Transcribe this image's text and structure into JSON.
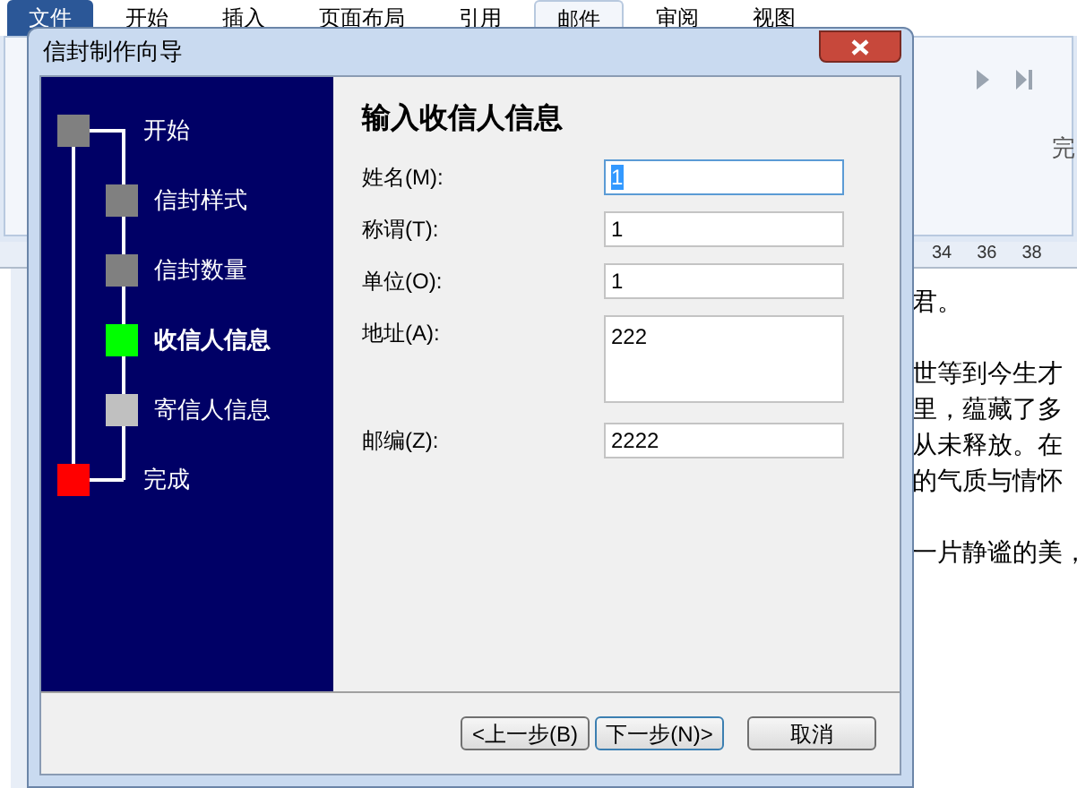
{
  "ribbon": {
    "file_button": "文件",
    "tabs": [
      {
        "label": "开始",
        "selected": false
      },
      {
        "label": "插入",
        "selected": false
      },
      {
        "label": "页面布局",
        "selected": false
      },
      {
        "label": "引用",
        "selected": false
      },
      {
        "label": "邮件",
        "selected": true
      },
      {
        "label": "审阅",
        "selected": false
      },
      {
        "label": "视图",
        "selected": false
      }
    ],
    "group_label": "完"
  },
  "ruler": {
    "ticks": [
      "34",
      "36",
      "38"
    ]
  },
  "document": {
    "paragraphs": [
      [
        "君。"
      ],
      [
        "世等到今生才",
        "里，蕴藏了多",
        "从未释放。在",
        "的气质与情怀"
      ],
      [
        "一片静谧的美，"
      ]
    ]
  },
  "dialog": {
    "title": "信封制作向导",
    "steps": [
      {
        "label": "开始",
        "kind": "outer",
        "color": "#808080",
        "selected": false
      },
      {
        "label": "信封样式",
        "kind": "inner",
        "color": "#808080",
        "selected": false
      },
      {
        "label": "信封数量",
        "kind": "inner",
        "color": "#808080",
        "selected": false
      },
      {
        "label": "收信人信息",
        "kind": "inner",
        "color": "#00ff00",
        "selected": true
      },
      {
        "label": "寄信人信息",
        "kind": "inner",
        "color": "#c0c0c0",
        "selected": false
      },
      {
        "label": "完成",
        "kind": "outer",
        "color": "#ff0000",
        "selected": false
      }
    ],
    "heading": "输入收信人信息",
    "fields": [
      {
        "label": "姓名(M):",
        "value": "1",
        "kind": "line",
        "focused": true
      },
      {
        "label": "称谓(T):",
        "value": "1",
        "kind": "line",
        "focused": false
      },
      {
        "label": "单位(O):",
        "value": "1",
        "kind": "line",
        "focused": false
      },
      {
        "label": "地址(A):",
        "value": "222",
        "kind": "multiline",
        "focused": false
      },
      {
        "label": "邮编(Z):",
        "value": "2222",
        "kind": "line",
        "focused": false
      }
    ],
    "buttons": [
      {
        "label": "<上一步(B)",
        "default": false
      },
      {
        "label": "下一步(N)>",
        "default": true
      },
      {
        "label": "取消",
        "default": false
      }
    ]
  }
}
